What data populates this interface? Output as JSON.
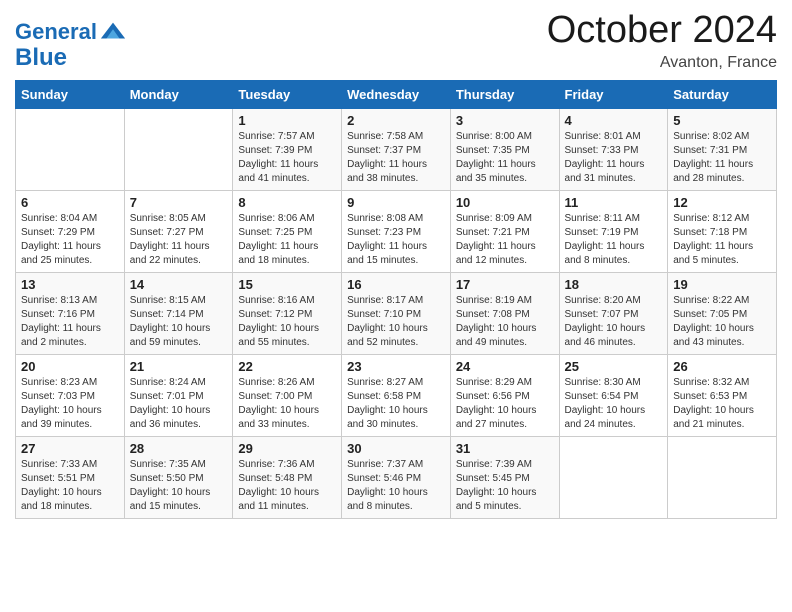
{
  "header": {
    "logo_line1": "General",
    "logo_line2": "Blue",
    "month_title": "October 2024",
    "location": "Avanton, France"
  },
  "days_of_week": [
    "Sunday",
    "Monday",
    "Tuesday",
    "Wednesday",
    "Thursday",
    "Friday",
    "Saturday"
  ],
  "weeks": [
    [
      {
        "day": "",
        "sunrise": "",
        "sunset": "",
        "daylight": ""
      },
      {
        "day": "",
        "sunrise": "",
        "sunset": "",
        "daylight": ""
      },
      {
        "day": "1",
        "sunrise": "Sunrise: 7:57 AM",
        "sunset": "Sunset: 7:39 PM",
        "daylight": "Daylight: 11 hours and 41 minutes."
      },
      {
        "day": "2",
        "sunrise": "Sunrise: 7:58 AM",
        "sunset": "Sunset: 7:37 PM",
        "daylight": "Daylight: 11 hours and 38 minutes."
      },
      {
        "day": "3",
        "sunrise": "Sunrise: 8:00 AM",
        "sunset": "Sunset: 7:35 PM",
        "daylight": "Daylight: 11 hours and 35 minutes."
      },
      {
        "day": "4",
        "sunrise": "Sunrise: 8:01 AM",
        "sunset": "Sunset: 7:33 PM",
        "daylight": "Daylight: 11 hours and 31 minutes."
      },
      {
        "day": "5",
        "sunrise": "Sunrise: 8:02 AM",
        "sunset": "Sunset: 7:31 PM",
        "daylight": "Daylight: 11 hours and 28 minutes."
      }
    ],
    [
      {
        "day": "6",
        "sunrise": "Sunrise: 8:04 AM",
        "sunset": "Sunset: 7:29 PM",
        "daylight": "Daylight: 11 hours and 25 minutes."
      },
      {
        "day": "7",
        "sunrise": "Sunrise: 8:05 AM",
        "sunset": "Sunset: 7:27 PM",
        "daylight": "Daylight: 11 hours and 22 minutes."
      },
      {
        "day": "8",
        "sunrise": "Sunrise: 8:06 AM",
        "sunset": "Sunset: 7:25 PM",
        "daylight": "Daylight: 11 hours and 18 minutes."
      },
      {
        "day": "9",
        "sunrise": "Sunrise: 8:08 AM",
        "sunset": "Sunset: 7:23 PM",
        "daylight": "Daylight: 11 hours and 15 minutes."
      },
      {
        "day": "10",
        "sunrise": "Sunrise: 8:09 AM",
        "sunset": "Sunset: 7:21 PM",
        "daylight": "Daylight: 11 hours and 12 minutes."
      },
      {
        "day": "11",
        "sunrise": "Sunrise: 8:11 AM",
        "sunset": "Sunset: 7:19 PM",
        "daylight": "Daylight: 11 hours and 8 minutes."
      },
      {
        "day": "12",
        "sunrise": "Sunrise: 8:12 AM",
        "sunset": "Sunset: 7:18 PM",
        "daylight": "Daylight: 11 hours and 5 minutes."
      }
    ],
    [
      {
        "day": "13",
        "sunrise": "Sunrise: 8:13 AM",
        "sunset": "Sunset: 7:16 PM",
        "daylight": "Daylight: 11 hours and 2 minutes."
      },
      {
        "day": "14",
        "sunrise": "Sunrise: 8:15 AM",
        "sunset": "Sunset: 7:14 PM",
        "daylight": "Daylight: 10 hours and 59 minutes."
      },
      {
        "day": "15",
        "sunrise": "Sunrise: 8:16 AM",
        "sunset": "Sunset: 7:12 PM",
        "daylight": "Daylight: 10 hours and 55 minutes."
      },
      {
        "day": "16",
        "sunrise": "Sunrise: 8:17 AM",
        "sunset": "Sunset: 7:10 PM",
        "daylight": "Daylight: 10 hours and 52 minutes."
      },
      {
        "day": "17",
        "sunrise": "Sunrise: 8:19 AM",
        "sunset": "Sunset: 7:08 PM",
        "daylight": "Daylight: 10 hours and 49 minutes."
      },
      {
        "day": "18",
        "sunrise": "Sunrise: 8:20 AM",
        "sunset": "Sunset: 7:07 PM",
        "daylight": "Daylight: 10 hours and 46 minutes."
      },
      {
        "day": "19",
        "sunrise": "Sunrise: 8:22 AM",
        "sunset": "Sunset: 7:05 PM",
        "daylight": "Daylight: 10 hours and 43 minutes."
      }
    ],
    [
      {
        "day": "20",
        "sunrise": "Sunrise: 8:23 AM",
        "sunset": "Sunset: 7:03 PM",
        "daylight": "Daylight: 10 hours and 39 minutes."
      },
      {
        "day": "21",
        "sunrise": "Sunrise: 8:24 AM",
        "sunset": "Sunset: 7:01 PM",
        "daylight": "Daylight: 10 hours and 36 minutes."
      },
      {
        "day": "22",
        "sunrise": "Sunrise: 8:26 AM",
        "sunset": "Sunset: 7:00 PM",
        "daylight": "Daylight: 10 hours and 33 minutes."
      },
      {
        "day": "23",
        "sunrise": "Sunrise: 8:27 AM",
        "sunset": "Sunset: 6:58 PM",
        "daylight": "Daylight: 10 hours and 30 minutes."
      },
      {
        "day": "24",
        "sunrise": "Sunrise: 8:29 AM",
        "sunset": "Sunset: 6:56 PM",
        "daylight": "Daylight: 10 hours and 27 minutes."
      },
      {
        "day": "25",
        "sunrise": "Sunrise: 8:30 AM",
        "sunset": "Sunset: 6:54 PM",
        "daylight": "Daylight: 10 hours and 24 minutes."
      },
      {
        "day": "26",
        "sunrise": "Sunrise: 8:32 AM",
        "sunset": "Sunset: 6:53 PM",
        "daylight": "Daylight: 10 hours and 21 minutes."
      }
    ],
    [
      {
        "day": "27",
        "sunrise": "Sunrise: 7:33 AM",
        "sunset": "Sunset: 5:51 PM",
        "daylight": "Daylight: 10 hours and 18 minutes."
      },
      {
        "day": "28",
        "sunrise": "Sunrise: 7:35 AM",
        "sunset": "Sunset: 5:50 PM",
        "daylight": "Daylight: 10 hours and 15 minutes."
      },
      {
        "day": "29",
        "sunrise": "Sunrise: 7:36 AM",
        "sunset": "Sunset: 5:48 PM",
        "daylight": "Daylight: 10 hours and 11 minutes."
      },
      {
        "day": "30",
        "sunrise": "Sunrise: 7:37 AM",
        "sunset": "Sunset: 5:46 PM",
        "daylight": "Daylight: 10 hours and 8 minutes."
      },
      {
        "day": "31",
        "sunrise": "Sunrise: 7:39 AM",
        "sunset": "Sunset: 5:45 PM",
        "daylight": "Daylight: 10 hours and 5 minutes."
      },
      {
        "day": "",
        "sunrise": "",
        "sunset": "",
        "daylight": ""
      },
      {
        "day": "",
        "sunrise": "",
        "sunset": "",
        "daylight": ""
      }
    ]
  ]
}
